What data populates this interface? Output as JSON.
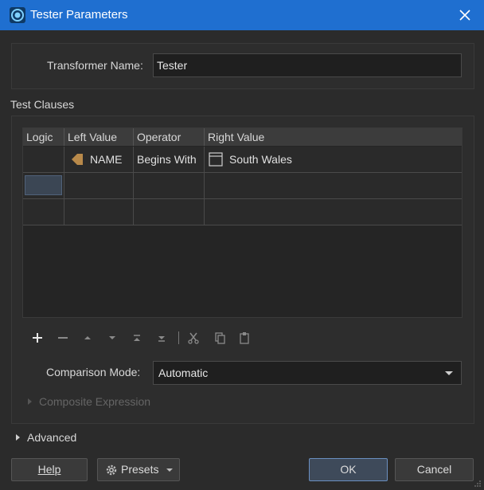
{
  "window": {
    "title": "Tester Parameters"
  },
  "transformer": {
    "label": "Transformer Name:",
    "value": "Tester"
  },
  "test_clauses": {
    "section_label": "Test Clauses",
    "columns": [
      "Logic",
      "Left Value",
      "Operator",
      "Right Value"
    ],
    "rows": [
      {
        "logic": "",
        "left_value": "NAME",
        "operator": "Begins With",
        "right_value": "South Wales"
      },
      {
        "logic": "",
        "left_value": "",
        "operator": "",
        "right_value": ""
      },
      {
        "logic": "",
        "left_value": "",
        "operator": "",
        "right_value": ""
      }
    ]
  },
  "comparison": {
    "label": "Comparison Mode:",
    "value": "Automatic"
  },
  "composite_expression": {
    "label": "Composite Expression"
  },
  "advanced": {
    "label": "Advanced"
  },
  "buttons": {
    "help": "Help",
    "presets": "Presets",
    "ok": "OK",
    "cancel": "Cancel"
  },
  "colors": {
    "titlebar": "#1f6fd0",
    "background": "#2b2b2b",
    "attribute_icon": "#b8894a"
  }
}
